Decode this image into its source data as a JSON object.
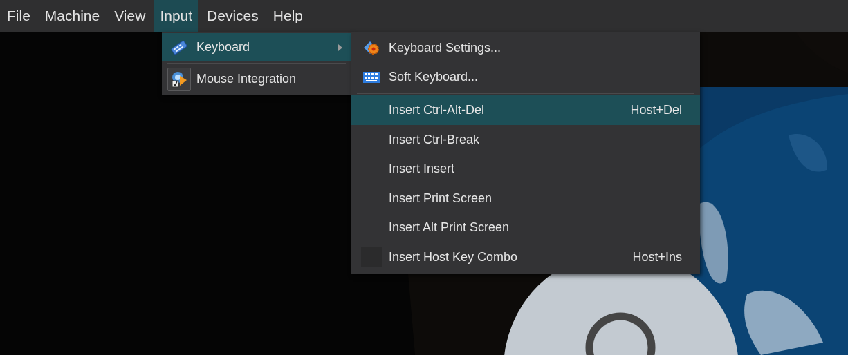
{
  "menubar": [
    {
      "label": "File",
      "selected": false
    },
    {
      "label": "Machine",
      "selected": false
    },
    {
      "label": "View",
      "selected": false
    },
    {
      "label": "Input",
      "selected": true
    },
    {
      "label": "Devices",
      "selected": false
    },
    {
      "label": "Help",
      "selected": false
    }
  ],
  "input_menu": {
    "items": [
      {
        "kind": "submenu",
        "label": "Keyboard",
        "selected": true
      },
      {
        "kind": "separator"
      },
      {
        "kind": "toggle",
        "label": "Mouse Integration",
        "checked": true,
        "selected": false
      }
    ]
  },
  "keyboard_menu": {
    "items": [
      {
        "kind": "action",
        "label": "Keyboard Settings...",
        "selected": false
      },
      {
        "kind": "action",
        "label": "Soft Keyboard...",
        "selected": false
      },
      {
        "kind": "separator"
      },
      {
        "kind": "action",
        "label": "Insert Ctrl-Alt-Del",
        "shortcut": "Host+Del",
        "selected": true
      },
      {
        "kind": "action",
        "label": "Insert Ctrl-Break",
        "selected": false
      },
      {
        "kind": "action",
        "label": "Insert Insert",
        "selected": false
      },
      {
        "kind": "action",
        "label": "Insert Print Screen",
        "selected": false
      },
      {
        "kind": "action",
        "label": "Insert Alt Print Screen",
        "selected": false
      },
      {
        "kind": "check",
        "label": "Insert Host Key Combo",
        "shortcut": "Host+Ins",
        "checked": false,
        "selected": false
      }
    ]
  }
}
